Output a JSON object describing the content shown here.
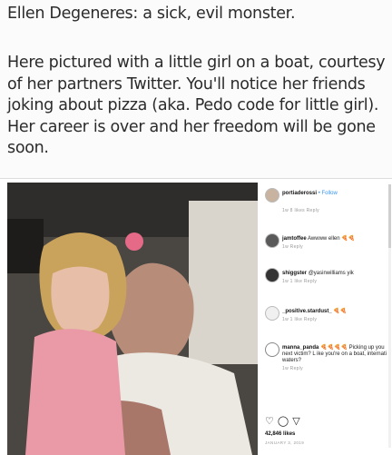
{
  "caption": {
    "headline": "Ellen Degeneres: a sick, evil monster.",
    "body": "Here pictured with a little girl on a boat, courtesy of her partners Twitter. You'll notice her friends joking about pizza (aka. Pedo code for little girl). Her career is over and her freedom will be gone soon."
  },
  "post": {
    "owner": {
      "username": "portiaderossi",
      "follow_label": "• Follow"
    },
    "owner_meta": "1w  8 likes  Reply",
    "comments": [
      {
        "username": "jamtoffee",
        "text": "Awwww ellen 🍕🍕",
        "meta": "1w  Reply"
      },
      {
        "username": "shiggster",
        "text": "@yasinwilliams yik",
        "meta": "1w  1 like  Reply"
      },
      {
        "username": "_positive.stardust_",
        "text": "🍕🍕",
        "meta": "1w  1 like  Reply"
      },
      {
        "username": "manna_panda",
        "text": "🍕🍕🍕🍕 Picking up you next victim? L ike you're on a boat, internati waters?",
        "meta": "1w  Reply"
      }
    ],
    "icons": [
      "heart-icon",
      "comment-icon",
      "share-icon"
    ],
    "likes": "42,846 likes",
    "date": "JANUARY 3, 2019"
  }
}
